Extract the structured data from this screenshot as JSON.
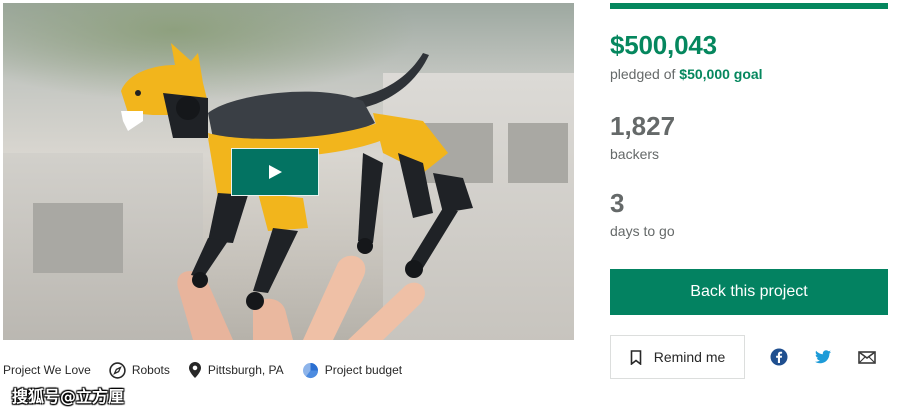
{
  "media": {
    "play_icon": "play-icon"
  },
  "campaign": {
    "progress_fraction": 1.0,
    "pledged_amount": "$500,043",
    "pledged_prefix": "pledged of ",
    "goal_amount": "$50,000 goal",
    "backers_count": "1,827",
    "backers_label": "backers",
    "days_count": "3",
    "days_label": "days to go"
  },
  "actions": {
    "back_label": "Back this project",
    "remind_label": "Remind me",
    "remind_icon": "bookmark-icon",
    "share": [
      {
        "icon": "facebook-icon"
      },
      {
        "icon": "twitter-icon"
      },
      {
        "icon": "email-icon"
      }
    ]
  },
  "meta": {
    "project_we_love": "Project We Love",
    "category": "Robots",
    "location": "Pittsburgh, PA",
    "budget": "Project budget"
  },
  "watermark": "搜狐号@立方厘",
  "colors": {
    "brand_green": "#05875e",
    "button_green": "#038261",
    "play_green": "#037362",
    "muted_text": "#656969"
  }
}
